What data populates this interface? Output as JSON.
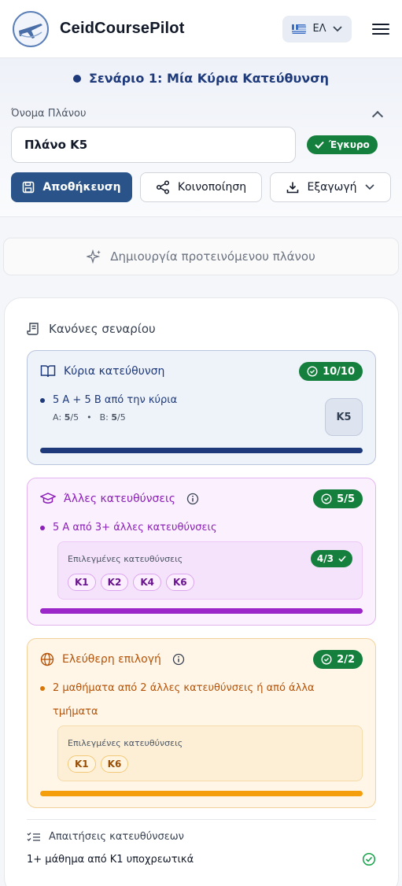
{
  "header": {
    "brand": "CeidCoursePilot",
    "language": "ΕΛ"
  },
  "scenario": {
    "title": "Σενάριο 1: Μία Κύρια Κατεύθυνση",
    "plan_label": "Όνομα Πλάνου",
    "plan_value": "Πλάνο Κ5",
    "valid_label": "Έγκυρο",
    "save_label": "Αποθήκευση",
    "share_label": "Κοινοποίηση",
    "export_label": "Εξαγωγή"
  },
  "generate_label": "Δημιουργία προτεινόμενου πλάνου",
  "rules": {
    "title": "Κανόνες σεναρίου",
    "main": {
      "title": "Κύρια κατεύθυνση",
      "badge": "10/10",
      "bullet": "5 Α + 5 Β από την κύρια",
      "a_label": "Α:",
      "a_value": "5",
      "a_total": "/5",
      "b_label": "Β:",
      "b_value": "5",
      "b_total": "/5",
      "direction": "Κ5",
      "progress": 1.0,
      "color": "#1e3a7a"
    },
    "other": {
      "title": "Άλλες κατευθύνσεις",
      "badge": "5/5",
      "bullet": "5 Α από 3+ άλλες κατευθύνσεις",
      "selected_label": "Επιλεγμένες κατευθύνσεις",
      "selected_badge": "4/3",
      "chips": [
        "Κ1",
        "Κ2",
        "Κ4",
        "Κ6"
      ],
      "progress": 1.0,
      "color": "#9b27c9"
    },
    "free": {
      "title": "Ελεύθερη επιλογή",
      "badge": "2/2",
      "bullet": "2 μαθήματα από 2 άλλες κατευθύνσεις ή από άλλα τμήματα",
      "selected_label": "Επιλεγμένες κατευθύνσεις",
      "chips": [
        "Κ1",
        "Κ6"
      ],
      "progress": 1.0,
      "color": "#d97706"
    },
    "requirements": {
      "title": "Απαιτήσεις κατευθύνσεων",
      "items": [
        {
          "label": "1+ μάθημα από Κ1 υποχρεωτικά",
          "status": "ok"
        }
      ]
    }
  }
}
